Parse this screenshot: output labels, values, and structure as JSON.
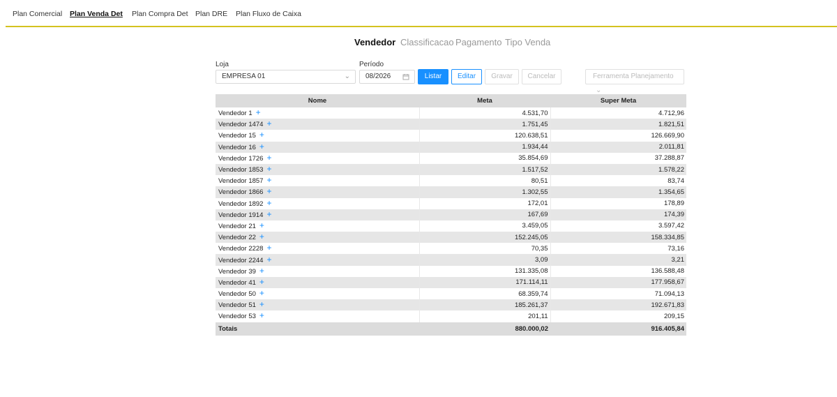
{
  "topnav": {
    "items": [
      {
        "label": "Plan Comercial",
        "active": false
      },
      {
        "label": "Plan Venda Det",
        "active": true
      },
      {
        "label": "Plan Compra Det",
        "active": false
      },
      {
        "label": "Plan DRE",
        "active": false
      },
      {
        "label": "Plan Fluxo de Caixa",
        "active": false
      }
    ]
  },
  "subtabs": [
    "Vendedor",
    "Classificacao",
    "Pagamento",
    "Tipo Venda"
  ],
  "filters": {
    "loja_label": "Loja",
    "loja_value": "EMPRESA 01",
    "periodo_label": "Período",
    "periodo_value": "08/2026"
  },
  "buttons": {
    "listar": "Listar",
    "editar": "Editar",
    "gravar": "Gravar",
    "cancelar": "Cancelar",
    "ferramenta": "Ferramenta Planejamento"
  },
  "table": {
    "headers": [
      "Nome",
      "Meta",
      "Super Meta"
    ],
    "rows": [
      [
        "Vendedor 1",
        "4.531,70",
        "4.712,96"
      ],
      [
        "Vendedor 1474",
        "1.751,45",
        "1.821,51"
      ],
      [
        "Vendedor 15",
        "120.638,51",
        "126.669,90"
      ],
      [
        "Vendedor 16",
        "1.934,44",
        "2.011,81"
      ],
      [
        "Vendedor 1726",
        "35.854,69",
        "37.288,87"
      ],
      [
        "Vendedor 1853",
        "1.517,52",
        "1.578,22"
      ],
      [
        "Vendedor 1857",
        "80,51",
        "83,74"
      ],
      [
        "Vendedor 1866",
        "1.302,55",
        "1.354,65"
      ],
      [
        "Vendedor 1892",
        "172,01",
        "178,89"
      ],
      [
        "Vendedor 1914",
        "167,69",
        "174,39"
      ],
      [
        "Vendedor 21",
        "3.459,05",
        "3.597,42"
      ],
      [
        "Vendedor 22",
        "152.245,05",
        "158.334,85"
      ],
      [
        "Vendedor 2228",
        "70,35",
        "73,16"
      ],
      [
        "Vendedor 2244",
        "3,09",
        "3,21"
      ],
      [
        "Vendedor 39",
        "131.335,08",
        "136.588,48"
      ],
      [
        "Vendedor 41",
        "171.114,11",
        "177.958,67"
      ],
      [
        "Vendedor 50",
        "68.359,74",
        "71.094,13"
      ],
      [
        "Vendedor 51",
        "185.261,37",
        "192.671,83"
      ],
      [
        "Vendedor 53",
        "201,11",
        "209,15"
      ]
    ],
    "totals": [
      "Totais",
      "880.000,02",
      "916.405,84"
    ]
  },
  "icons": {
    "expand": "plus-icon",
    "calendar": "calendar-icon",
    "dropdown": "chevron-down-icon"
  },
  "colors": {
    "accent": "#1890ff",
    "topline": "#d4c21f"
  }
}
